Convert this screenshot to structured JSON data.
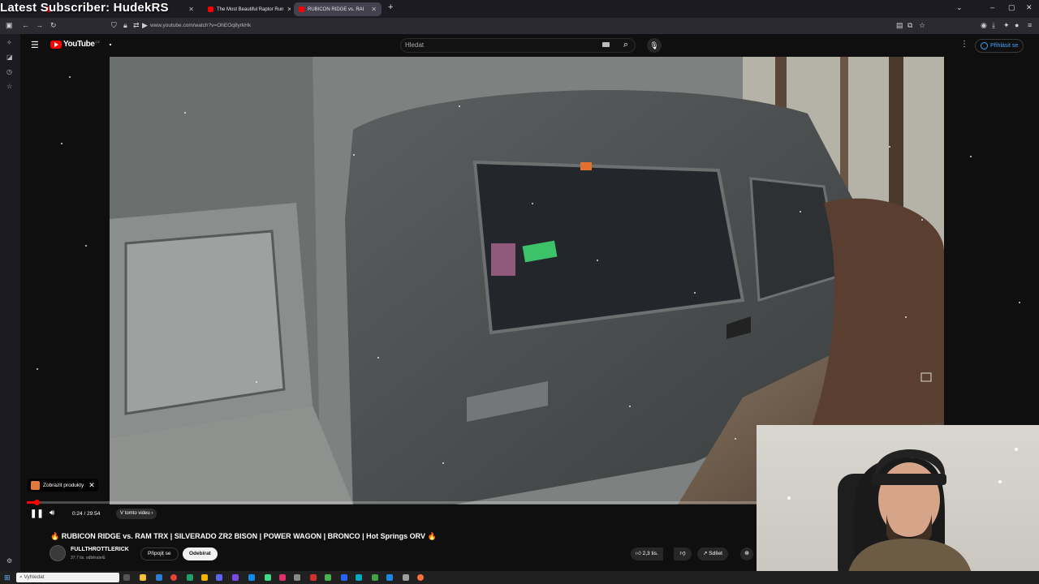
{
  "overlay": {
    "title": "Latest Subscriber: HudekRS"
  },
  "browser": {
    "tabs": [
      {
        "label": "The Most Beautiful Raptor Run"
      },
      {
        "label": "RUBICON RIDGE vs. RAI"
      }
    ],
    "url": "www.youtube.com/watch?v=OhEOq8yrkHk"
  },
  "youtube": {
    "logo": "YouTube",
    "logo_sup": "CZ",
    "search_placeholder": "Hledat",
    "signin": "Přihlásit se",
    "products_button": "Zobrazit produkty",
    "time": "0:24 / 29:54",
    "chapters": "V tomto videu",
    "title": "🔥 RUBICON RIDGE vs. RAM TRX | SILVERADO ZR2 BISON | POWER WAGON | BRONCO | Hot Springs ORV 🔥",
    "channel": "FULLTHROTTLERICK",
    "subscribers": "37,7 tis. odběratelů",
    "join": "Připojit se",
    "subscribe": "Odebírat",
    "likes": "2,3 tis.",
    "share": "Sdílet",
    "progress": 0.0134
  },
  "taskbar": {
    "search_placeholder": "Vyhledat"
  },
  "colors": {
    "accent": "#ff0000",
    "bg": "#0f0f0f"
  }
}
